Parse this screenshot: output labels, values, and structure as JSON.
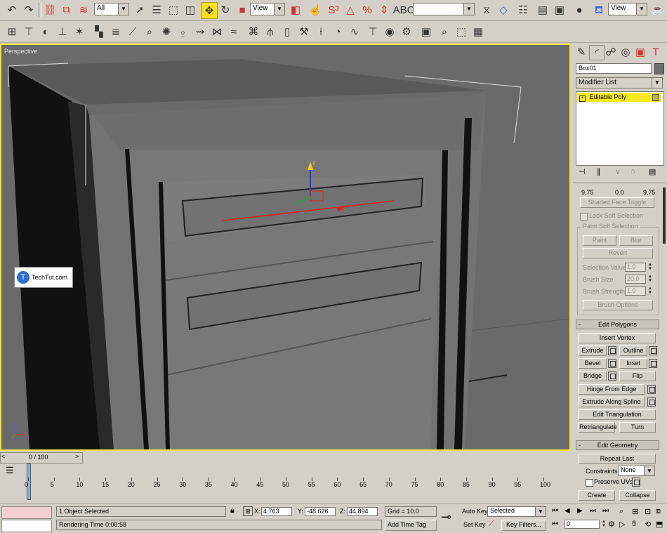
{
  "toolbar1": {
    "selection_filter": "All",
    "ref_coord_left": "View",
    "named_selection": "",
    "ref_coord_right": "View"
  },
  "viewport": {
    "label": "Perspective",
    "watermark": "TechTut.com",
    "gizmo_axes": {
      "x": "x",
      "y": "y",
      "z": "z"
    }
  },
  "command_panel": {
    "object_name": "Box01",
    "modifier_list": "Modifier List",
    "stack_item": "Editable Poly",
    "stack_color": "#f7ea1e",
    "truncated_values": [
      "9.75",
      "0.0",
      "9.75"
    ],
    "shaded_face_toggle": "Shaded Face Toggle",
    "lock_soft_selection": "Lock Soft Selection",
    "paint_soft_selection": "Paint Soft Selection",
    "paint": "Paint",
    "blur": "Blur",
    "revert": "Revert",
    "selection_value_label": "Selection Value",
    "selection_value": "1.0",
    "brush_size_label": "Brush Size",
    "brush_size": "20.0",
    "brush_strength_label": "Brush Strength",
    "brush_strength": "1.0",
    "brush_options": "Brush Options",
    "edit_polygons": "Edit Polygons",
    "insert_vertex": "Insert Vertex",
    "extrude": "Extrude",
    "outline": "Outline",
    "bevel": "Bevel",
    "inset": "Inset",
    "bridge": "Bridge",
    "flip": "Flip",
    "hinge_from_edge": "Hinge From Edge",
    "extrude_along_spline": "Extrude Along Spline",
    "edit_triangulation": "Edit Triangulation",
    "retriangulate": "Retriangulate",
    "turn": "Turn",
    "edit_geometry": "Edit Geometry",
    "repeat_last": "Repeat Last",
    "constraints_label": "Constraints:",
    "constraints_value": "None",
    "preserve_uvs": "Preserve UVs",
    "create": "Create",
    "collapse": "Collapse"
  },
  "timeline": {
    "frame_display": "0 / 100",
    "ticks": [
      "0",
      "5",
      "10",
      "15",
      "20",
      "25",
      "30",
      "35",
      "40",
      "45",
      "50",
      "55",
      "60",
      "65",
      "70",
      "75",
      "80",
      "85",
      "90",
      "95",
      "100"
    ]
  },
  "status": {
    "selection": "1 Object Selected",
    "rendering": "Rendering Time  0:00:58",
    "x_label": "X:",
    "x": "4.763",
    "y_label": "Y:",
    "y": "-48.626",
    "z_label": "Z:",
    "z": "44.894",
    "grid": "Grid = 10.0",
    "add_time_tag": "Add Time Tag",
    "auto_key": "Auto Key",
    "set_key": "Set Key",
    "key_mode": "Selected",
    "key_filters": "Key Filters...",
    "current_frame": "0"
  }
}
